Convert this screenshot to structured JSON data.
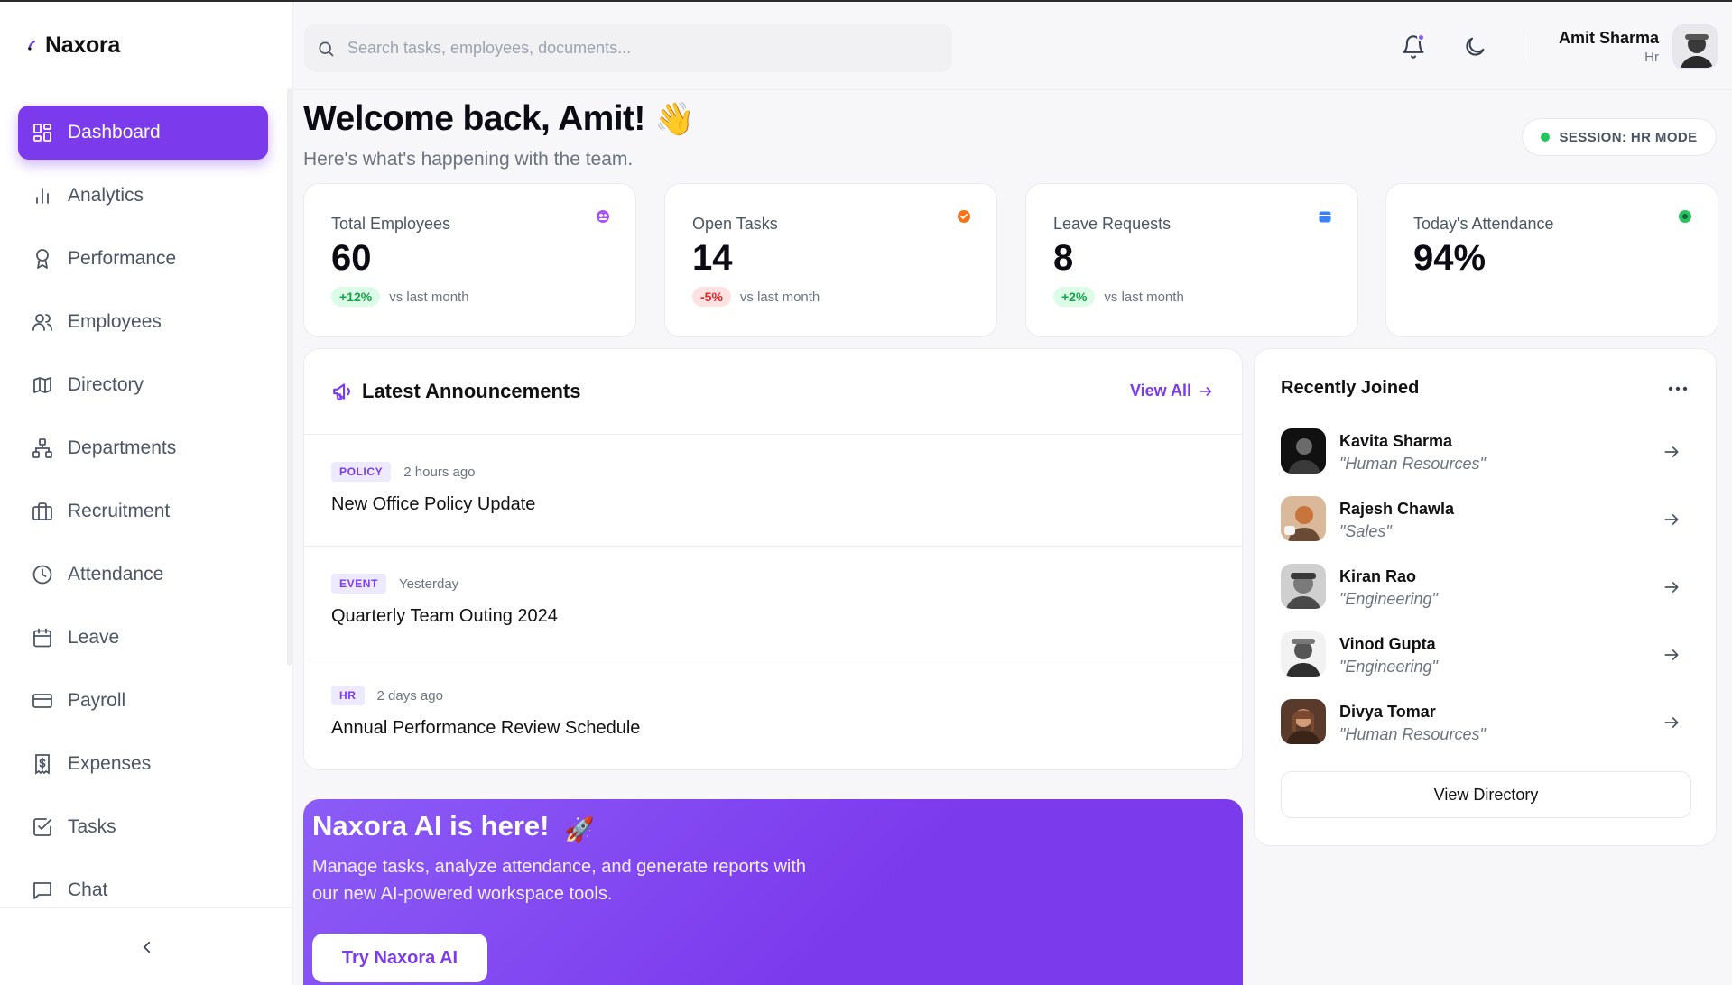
{
  "brand": {
    "name": "Naxora"
  },
  "sidebar": {
    "items": [
      {
        "label": "Dashboard",
        "icon": "dashboard-icon",
        "active": true
      },
      {
        "label": "Analytics",
        "icon": "bar-chart-icon"
      },
      {
        "label": "Performance",
        "icon": "award-icon"
      },
      {
        "label": "Employees",
        "icon": "users-icon"
      },
      {
        "label": "Directory",
        "icon": "map-icon"
      },
      {
        "label": "Departments",
        "icon": "org-chart-icon"
      },
      {
        "label": "Recruitment",
        "icon": "briefcase-icon"
      },
      {
        "label": "Attendance",
        "icon": "clock-icon"
      },
      {
        "label": "Leave",
        "icon": "calendar-icon"
      },
      {
        "label": "Payroll",
        "icon": "credit-card-icon"
      },
      {
        "label": "Expenses",
        "icon": "dollar-receipt-icon"
      },
      {
        "label": "Tasks",
        "icon": "checkbox-icon"
      },
      {
        "label": "Chat",
        "icon": "chat-icon"
      }
    ]
  },
  "header": {
    "search_placeholder": "Search tasks, employees, documents...",
    "user": {
      "name": "Amit Sharma",
      "role": "Hr"
    }
  },
  "welcome": {
    "title": "Welcome back, Amit!",
    "emoji": "👋",
    "subtitle": "Here's what's happening with the team.",
    "session": "SESSION: HR MODE"
  },
  "stats": [
    {
      "label": "Total Employees",
      "value": "60",
      "change": "+12%",
      "trend": "up",
      "note": "vs last month",
      "icon": "users-icon",
      "icon_color": "#a855f7"
    },
    {
      "label": "Open Tasks",
      "value": "14",
      "change": "-5%",
      "trend": "down",
      "note": "vs last month",
      "icon": "task-icon",
      "icon_color": "#f97316"
    },
    {
      "label": "Leave Requests",
      "value": "8",
      "change": "+2%",
      "trend": "up",
      "note": "vs last month",
      "icon": "calendar-icon",
      "icon_color": "#3b82f6"
    },
    {
      "label": "Today's Attendance",
      "value": "94%",
      "icon": "check-circle-icon",
      "icon_color": "#22c55e"
    }
  ],
  "announcements": {
    "title": "Latest Announcements",
    "view_all": "View All",
    "items": [
      {
        "tag": "POLICY",
        "time": "2 hours ago",
        "title": "New Office Policy Update"
      },
      {
        "tag": "EVENT",
        "time": "Yesterday",
        "title": "Quarterly Team Outing 2024"
      },
      {
        "tag": "HR",
        "time": "2 days ago",
        "title": "Annual Performance Review Schedule"
      }
    ]
  },
  "recent": {
    "title": "Recently Joined",
    "people": [
      {
        "name": "Kavita Sharma",
        "dept": "\"Human Resources\""
      },
      {
        "name": "Rajesh Chawla",
        "dept": "\"Sales\""
      },
      {
        "name": "Kiran Rao",
        "dept": "\"Engineering\""
      },
      {
        "name": "Vinod Gupta",
        "dept": "\"Engineering\""
      },
      {
        "name": "Divya Tomar",
        "dept": "\"Human Resources\""
      }
    ],
    "view_directory": "View Directory"
  },
  "ai": {
    "title": "Naxora AI is here!",
    "emoji": "🚀",
    "description": "Manage tasks, analyze attendance, and generate reports with our new AI-powered workspace tools.",
    "button": "Try Naxora AI"
  },
  "colors": {
    "accent": "#7c3aed",
    "positive": "#16a34a",
    "negative": "#dc2626"
  }
}
